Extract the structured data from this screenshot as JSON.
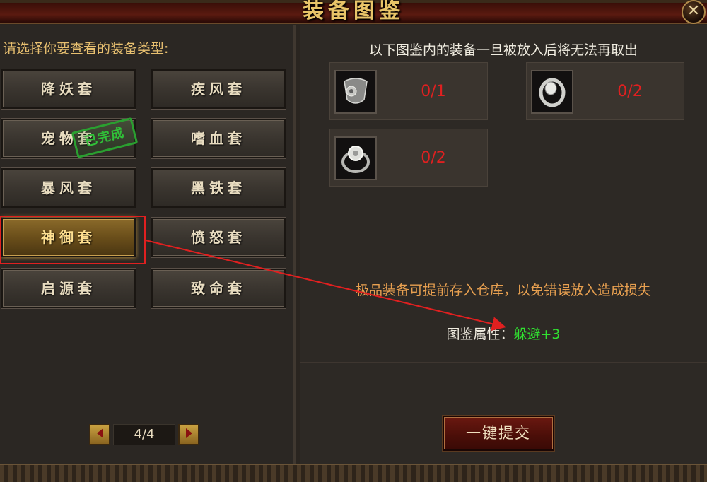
{
  "window": {
    "title": "装备图鉴",
    "close_label": "✕"
  },
  "left": {
    "header": "请选择你要查看的装备类型:",
    "sets": [
      {
        "label": "降妖套"
      },
      {
        "label": "疾风套"
      },
      {
        "label": "宠物套"
      },
      {
        "label": "嗜血套"
      },
      {
        "label": "暴风套"
      },
      {
        "label": "黑铁套"
      },
      {
        "label": "神御套"
      },
      {
        "label": "愤怒套"
      },
      {
        "label": "启源套"
      },
      {
        "label": "致命套"
      }
    ],
    "selected_set": "神御套",
    "completed_stamp": "已完成",
    "pager": {
      "text": "4/4"
    }
  },
  "right": {
    "notice": "以下图鉴内的装备一旦被放入后将无法再取出",
    "slots": [
      {
        "icon": "necklace-icon",
        "count": "0/1"
      },
      {
        "icon": "bracelet-icon",
        "count": "0/2"
      },
      {
        "icon": "ring-icon",
        "count": "0/2"
      }
    ],
    "tip": "极品装备可提前存入仓库，以免错误放入造成损失",
    "attribute_label": "图鉴属性：",
    "attribute_value": "躲避+3",
    "submit_label": "一键提交"
  },
  "colors": {
    "count_red": "#e02020",
    "attr_green": "#30e030",
    "tip_orange": "#e8a050",
    "title_gold": "#e8c468"
  }
}
